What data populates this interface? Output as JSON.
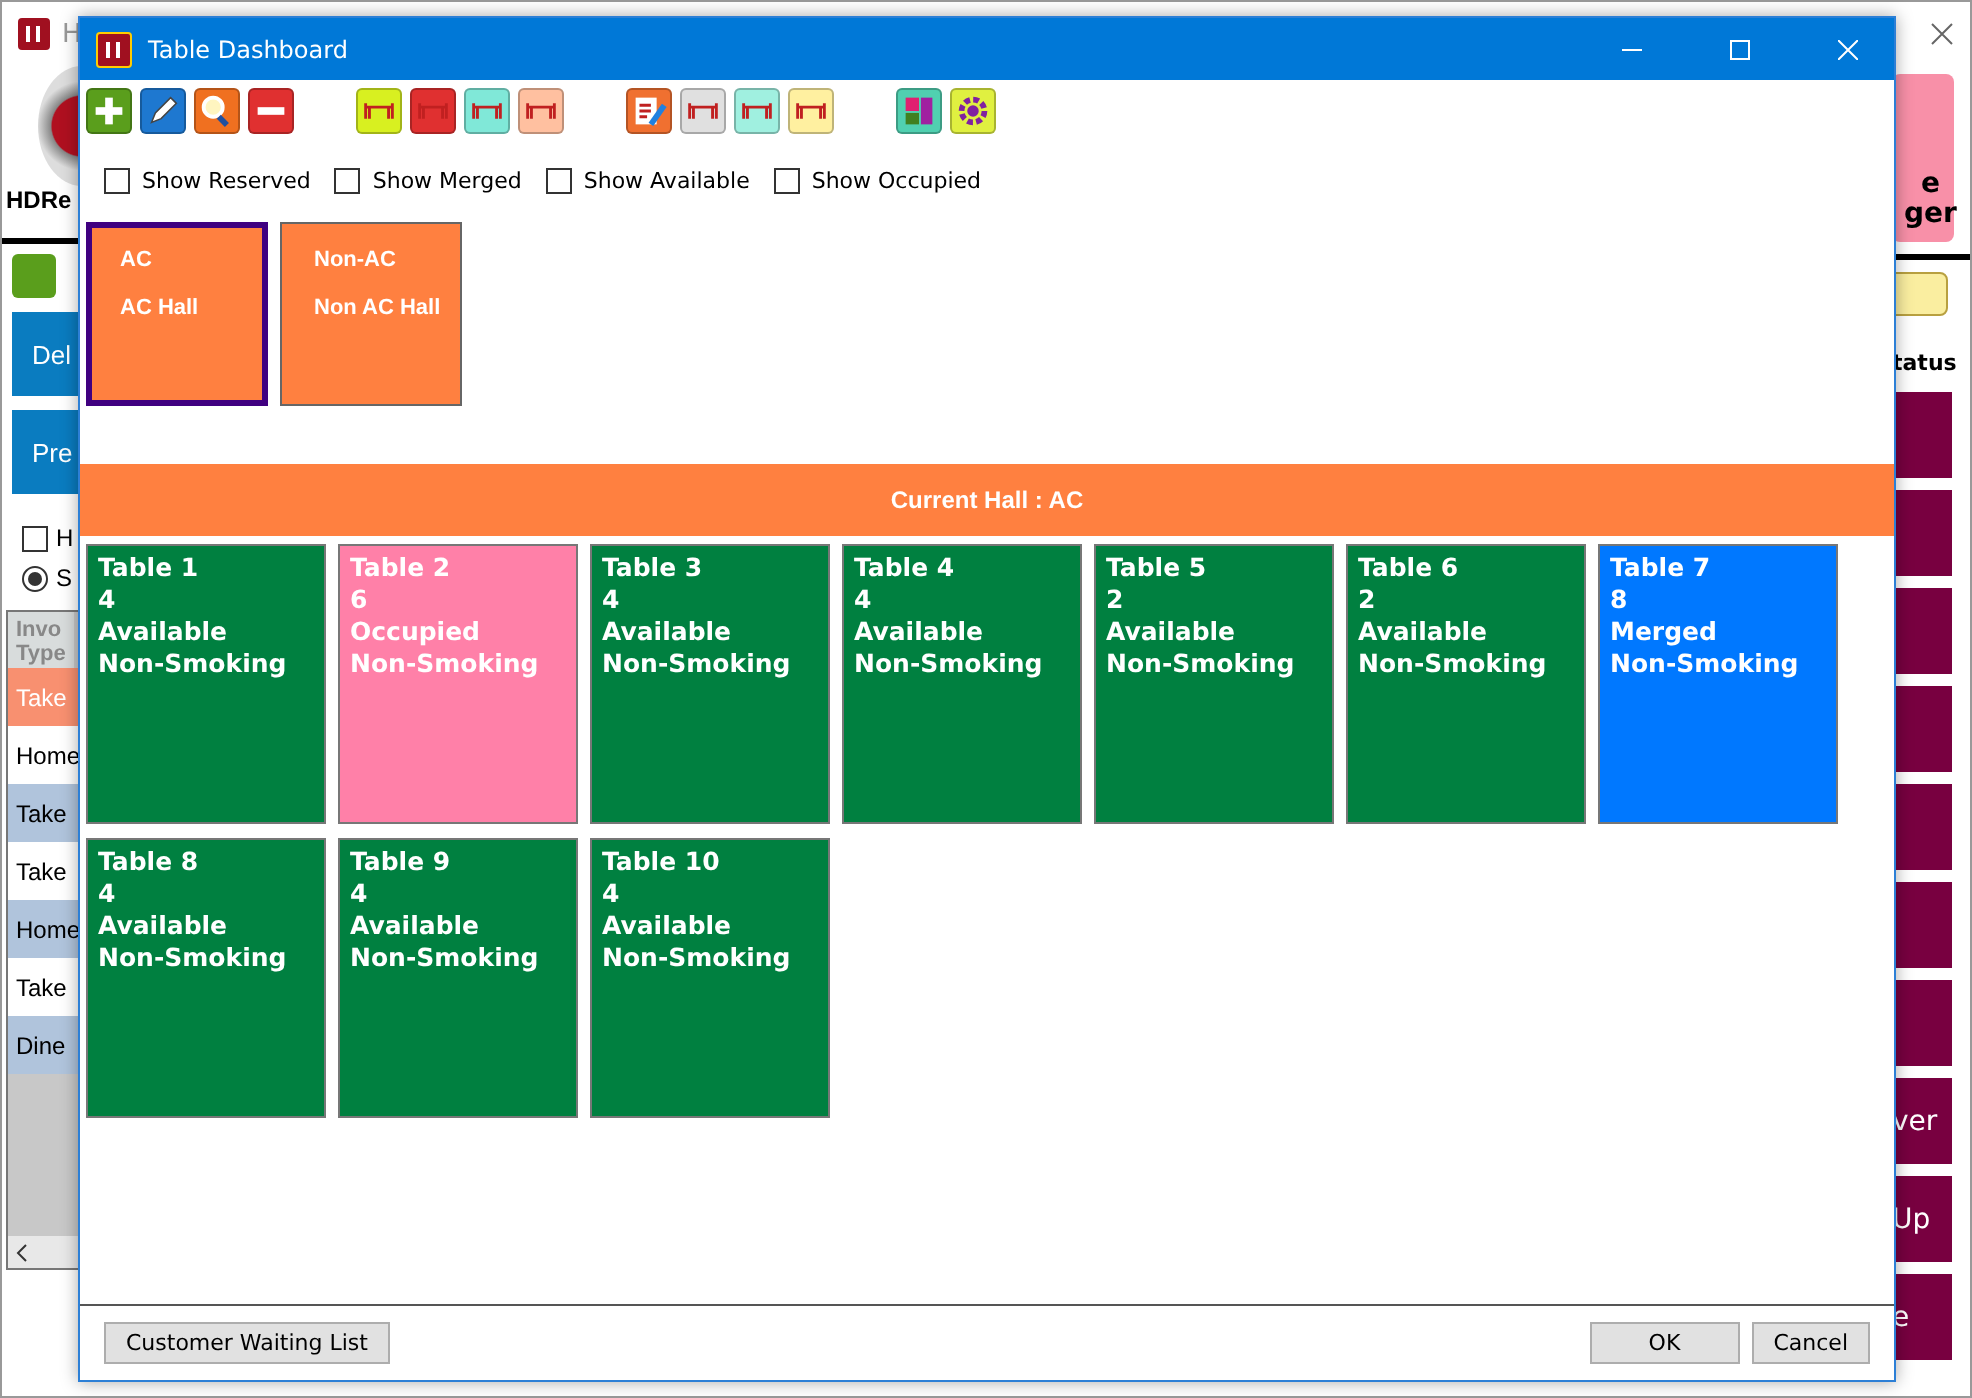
{
  "background_app": {
    "title_fragment": "H",
    "logo_text": "HDRe",
    "left_buttons": [
      "Del",
      "Pre"
    ],
    "options": [
      {
        "label": "H",
        "kind": "checkbox",
        "checked": false
      },
      {
        "label": "S",
        "kind": "radio",
        "checked": true
      }
    ],
    "list_header": "Invo\nType",
    "list_rows": [
      {
        "text": "Take",
        "selected": true
      },
      {
        "text": "Home",
        "selected": false
      },
      {
        "text": "Take",
        "selected": false
      },
      {
        "text": "Take",
        "selected": false
      },
      {
        "text": "Home",
        "selected": false
      },
      {
        "text": "Take",
        "selected": false
      },
      {
        "text": "Dine",
        "selected": false
      }
    ],
    "right_top_button": "e\nger",
    "status_header": "tatus",
    "right_buttons": [
      {
        "kind": "blank"
      },
      {
        "kind": "blank"
      },
      {
        "kind": "blank"
      },
      {
        "kind": "blank"
      },
      {
        "kind": "blank"
      },
      {
        "kind": "blank"
      },
      {
        "kind": "blank"
      },
      {
        "kind": "text",
        "label": "ver"
      },
      {
        "kind": "text",
        "label": "Up"
      },
      {
        "kind": "text",
        "label": "e"
      }
    ]
  },
  "window": {
    "title": "Table Dashboard"
  },
  "filters": [
    {
      "label": "Show Reserved",
      "checked": false
    },
    {
      "label": "Show Merged",
      "checked": false
    },
    {
      "label": "Show Available",
      "checked": false
    },
    {
      "label": "Show Occupied",
      "checked": false
    }
  ],
  "halls": [
    {
      "code": "AC",
      "name": "AC Hall",
      "selected": true
    },
    {
      "code": "Non-AC",
      "name": "Non AC Hall",
      "selected": false
    }
  ],
  "current_hall": "Current Hall : AC",
  "tables": [
    {
      "name": "Table 1",
      "seats": "4",
      "status": "Available",
      "smoking": "Non-Smoking",
      "color": "#008040"
    },
    {
      "name": "Table 2",
      "seats": "6",
      "status": "Occupied",
      "smoking": "Non-Smoking",
      "color": "#ff80a8"
    },
    {
      "name": "Table 3",
      "seats": "4",
      "status": "Available",
      "smoking": "Non-Smoking",
      "color": "#008040"
    },
    {
      "name": "Table 4",
      "seats": "4",
      "status": "Available",
      "smoking": "Non-Smoking",
      "color": "#008040"
    },
    {
      "name": "Table 5",
      "seats": "2",
      "status": "Available",
      "smoking": "Non-Smoking",
      "color": "#008040"
    },
    {
      "name": "Table 6",
      "seats": "2",
      "status": "Available",
      "smoking": "Non-Smoking",
      "color": "#008040"
    },
    {
      "name": "Table 7",
      "seats": "8",
      "status": "Merged",
      "smoking": "Non-Smoking",
      "color": "#0078ff"
    },
    {
      "name": "Table 8",
      "seats": "4",
      "status": "Available",
      "smoking": "Non-Smoking",
      "color": "#008040"
    },
    {
      "name": "Table 9",
      "seats": "4",
      "status": "Available",
      "smoking": "Non-Smoking",
      "color": "#008040"
    },
    {
      "name": "Table 10",
      "seats": "4",
      "status": "Available",
      "smoking": "Non-Smoking",
      "color": "#008040"
    }
  ],
  "footer": {
    "left_button": "Customer Waiting List",
    "buttons": [
      "OK",
      "Cancel"
    ]
  }
}
